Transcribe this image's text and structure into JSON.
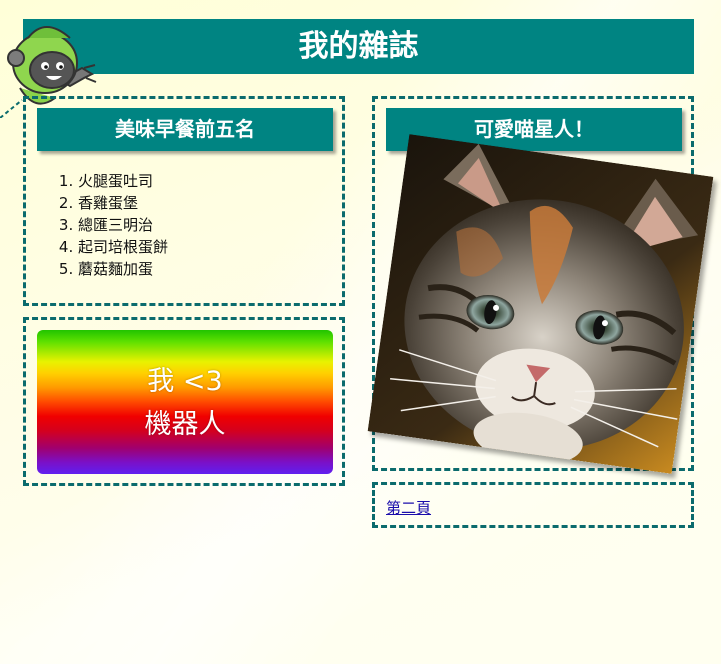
{
  "header": {
    "title": "我的雜誌"
  },
  "breakfast": {
    "title": "美味早餐前五名",
    "items": [
      "火腿蛋吐司",
      "香雞蛋堡",
      "總匯三明治",
      "起司培根蛋餅",
      "蘑菇麵加蛋"
    ]
  },
  "robot_banner": {
    "line1": "我 <3",
    "line2": "機器人"
  },
  "cat": {
    "title": "可愛喵星人！"
  },
  "nav": {
    "page2_label": "第二頁"
  },
  "colors": {
    "accent": "#008482",
    "border": "#0b6b6d",
    "link": "#1a0dab"
  },
  "icons": {
    "logo": "robot-mascot-icon"
  }
}
